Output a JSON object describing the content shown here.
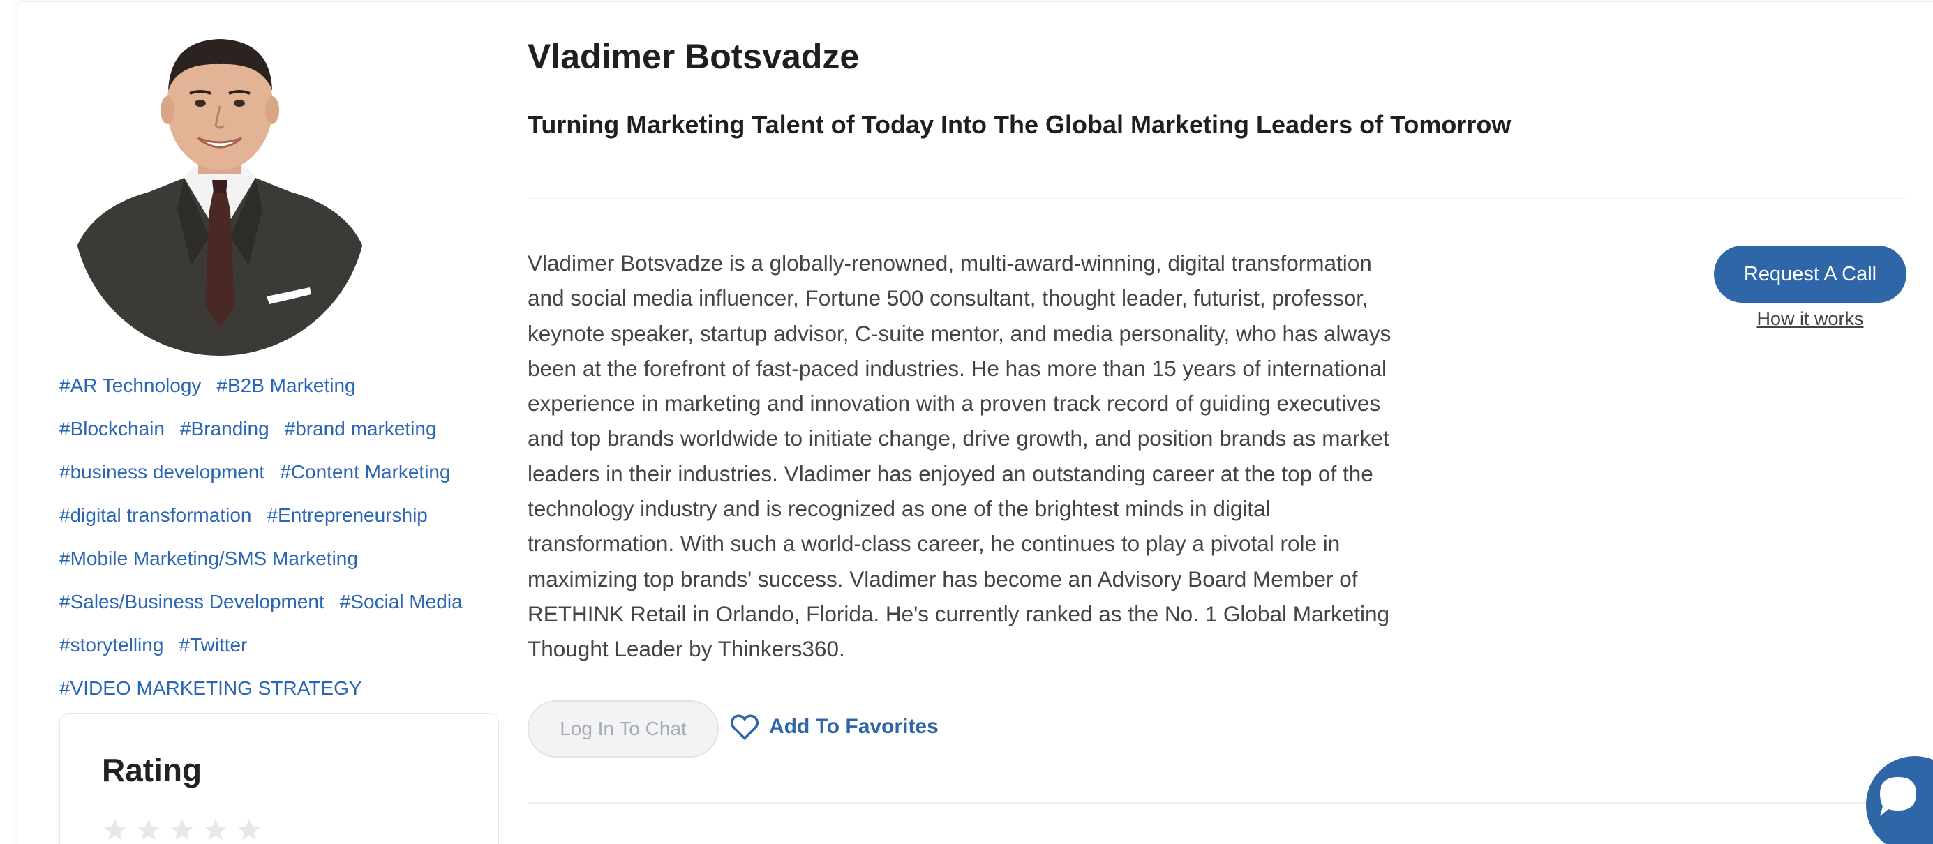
{
  "profile": {
    "name": "Vladimer Botsvadze",
    "headline": "Turning Marketing Talent of Today Into The Global Marketing Leaders of Tomorrow",
    "bio": "Vladimer Botsvadze is a globally-renowned, multi-award-winning, digital transformation and social media influencer, Fortune 500 consultant, thought leader, futurist, professor, keynote speaker, startup advisor, C-suite mentor, and media personality, who has always been at the forefront of fast-paced industries. He has more than 15 years of international experience in marketing and innovation with a proven track record of guiding executives and top brands worldwide to initiate change, drive growth, and position brands as market leaders in their industries. Vladimer has enjoyed an outstanding career at the top of the technology industry and is recognized as one of the brightest minds in digital transformation. With such a world-class career, he continues to play a pivotal role in maximizing top brands' success. Vladimer has become an Advisory Board Member of RETHINK Retail in Orlando, Florida. He's currently ranked as the No. 1 Global Marketing Thought Leader by Thinkers360."
  },
  "tags": {
    "rows": [
      [
        "#AR Technology",
        "#B2B Marketing"
      ],
      [
        "#Blockchain",
        "#Branding",
        "#brand marketing"
      ],
      [
        "#business development",
        "#Content Marketing"
      ],
      [
        "#digital transformation",
        "#Entrepreneurship"
      ],
      [
        "#Mobile Marketing/SMS Marketing"
      ],
      [
        "#Sales/Business Development",
        "#Social Media"
      ],
      [
        "#storytelling",
        "#Twitter"
      ],
      [
        "#VIDEO MARKETING STRATEGY"
      ]
    ]
  },
  "rating": {
    "title": "Rating",
    "stars_filled": 0,
    "stars_total": 5
  },
  "actions": {
    "request_call": "Request A Call",
    "how_it_works": "How it works",
    "chat": "Log In To Chat",
    "favorites": "Add To Favorites"
  },
  "colors": {
    "accent": "#2e66a8",
    "tag": "#2a66b3",
    "star_empty": "#e8e8e8"
  },
  "icons": {
    "favorites": "heart-icon",
    "chat_widget": "chat-bubble-icon",
    "rating": "star-icon"
  }
}
